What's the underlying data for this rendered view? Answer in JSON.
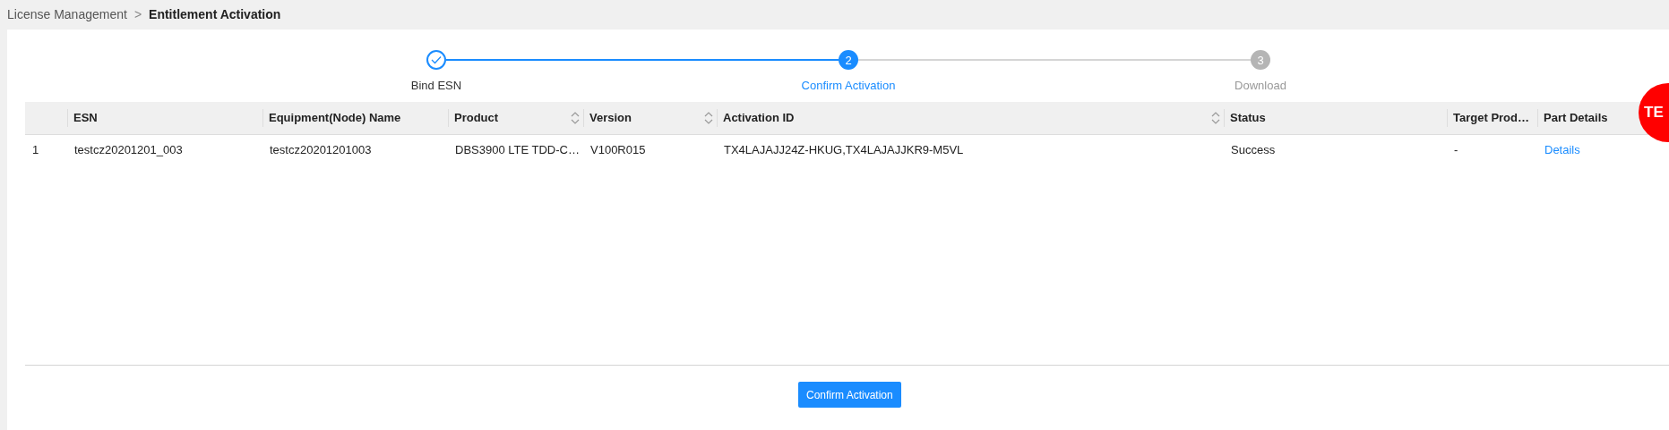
{
  "breadcrumb": {
    "parent": "License Management",
    "separator": ">",
    "current": "Entitlement Activation"
  },
  "steps": [
    {
      "label": "Bind ESN",
      "completed": true,
      "selected": false
    },
    {
      "number": "2",
      "label": "Confirm Activation",
      "completed": false,
      "selected": true
    },
    {
      "number": "3",
      "label": "Download",
      "completed": false,
      "selected": false
    }
  ],
  "table": {
    "columns": [
      {
        "sortable": false
      },
      {
        "label": "ESN",
        "sortable": false
      },
      {
        "label": "Equipment(Node) Name",
        "sortable": false
      },
      {
        "label": "Product",
        "sortable": true
      },
      {
        "label": "Version",
        "sortable": true
      },
      {
        "label": "Activation ID",
        "sortable": true
      },
      {
        "label": "Status",
        "sortable": false
      },
      {
        "label": "Target Prod…",
        "sortable": false
      },
      {
        "label": "Part Details",
        "sortable": false
      }
    ],
    "rows": [
      {
        "cells": [
          "1",
          "testcz20201201_003",
          "testcz20201201003",
          "DBS3900 LTE TDD-C…",
          "V100R015",
          "TX4LAJAJJ24Z-HKUG,TX4LAJAJJKR9-M5VL",
          "Success",
          "-"
        ],
        "link": "Details"
      }
    ]
  },
  "badge": "TE",
  "confirm_button": "Confirm Activation"
}
